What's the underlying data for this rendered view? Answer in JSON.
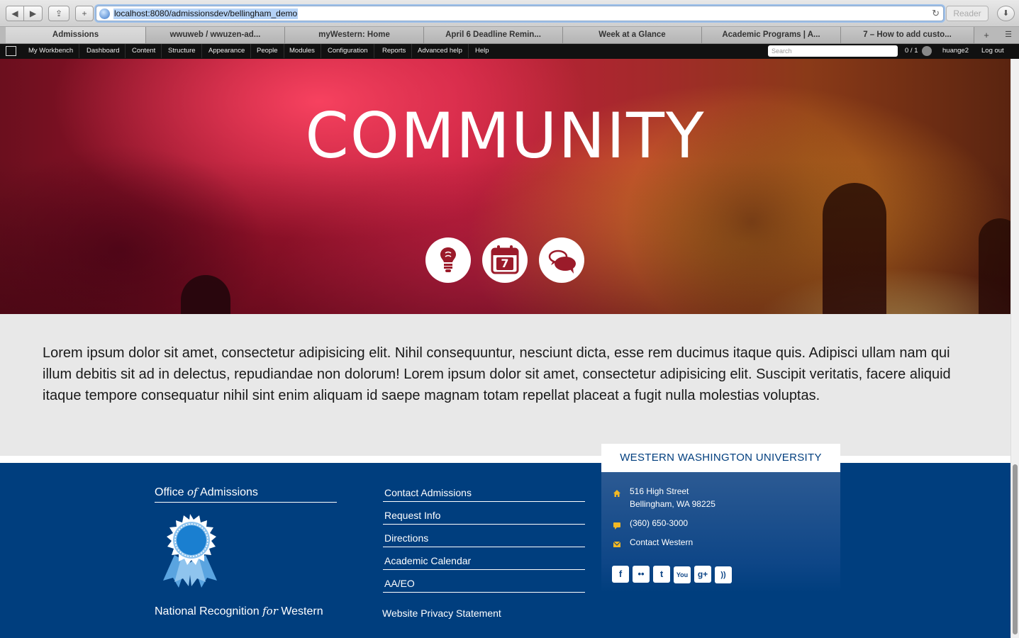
{
  "browser": {
    "back_label": "◀",
    "forward_label": "▶",
    "share_label": "⇪",
    "add_label": "+",
    "url": "localhost:8080/admissionsdev/bellingham_demo",
    "reload_label": "↻",
    "reader_label": "Reader",
    "download_label": "⬇",
    "tabs": [
      "Admissions",
      "wwuweb / wwuzen-ad...",
      "myWestern: Home",
      "April 6 Deadline Remin...",
      "Week at a Glance",
      "Academic Programs | A...",
      "7 – How to add custo..."
    ],
    "newtab_label": "+",
    "tablist_label": "☰"
  },
  "admin_bar": {
    "items": [
      "My Workbench",
      "Dashboard",
      "Content",
      "Structure",
      "Appearance",
      "People",
      "Modules",
      "Configuration",
      "Reports",
      "Advanced help",
      "Help"
    ],
    "search_placeholder": "Search",
    "count": "0 / 1",
    "user": "huange2",
    "logout": "Log out"
  },
  "hero": {
    "title": "COMMUNITY",
    "icons": [
      "lightbulb-icon",
      "calendar-icon",
      "chat-bubbles-icon"
    ],
    "calendar_number": "7"
  },
  "content": {
    "paragraph": "Lorem ipsum dolor sit amet, consectetur adipisicing elit. Nihil consequuntur, nesciunt dicta, esse rem ducimus itaque quis. Adipisci ullam nam qui illum debitis sit ad in delectus, repudiandae non dolorum! Lorem ipsum dolor sit amet, consectetur adipisicing elit. Suscipit veritatis, facere aliquid itaque tempore consequatur nihil sint enim aliquam id saepe magnam totam repellat placeat a fugit nulla molestias voluptas."
  },
  "footer": {
    "office_prefix": "Office",
    "office_of": "of",
    "office_suffix": "Admissions",
    "recognition_prefix": "National Recognition",
    "recognition_for": "for",
    "recognition_suffix": "Western",
    "links": [
      "Contact Admissions",
      "Request Info",
      "Directions",
      "Academic Calendar",
      "AA/EO"
    ],
    "privacy": "Website Privacy Statement",
    "university": "WESTERN WASHINGTON UNIVERSITY",
    "address_line1": "516 High Street",
    "address_line2": "Bellingham, WA 98225",
    "phone": "(360) 650-3000",
    "contact": "Contact Western",
    "social": [
      {
        "name": "facebook-icon",
        "glyph": "f"
      },
      {
        "name": "flickr-icon",
        "glyph": "••"
      },
      {
        "name": "twitter-icon",
        "glyph": "t"
      },
      {
        "name": "youtube-icon",
        "glyph": "You"
      },
      {
        "name": "google-plus-icon",
        "glyph": "g+"
      },
      {
        "name": "rss-icon",
        "glyph": "))"
      }
    ]
  },
  "colors": {
    "footer_blue": "#003e7e",
    "card_yellow": "#f2b824",
    "hero_red": "#c01d3c"
  }
}
